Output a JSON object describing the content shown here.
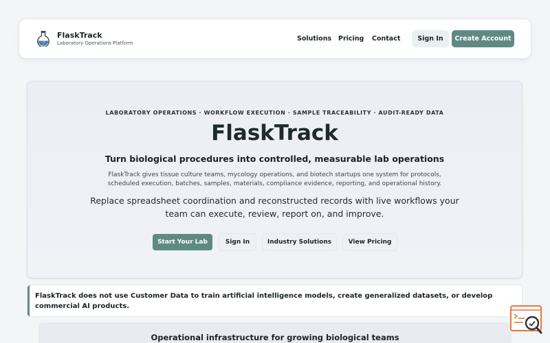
{
  "brand": {
    "name": "FlaskTrack",
    "tagline": "Laboratory Operations Platform",
    "logo_icon": "flask-icon"
  },
  "nav": {
    "links": [
      "Solutions",
      "Pricing",
      "Contact"
    ],
    "sign_in": "Sign In",
    "create_account": "Create Account"
  },
  "hero": {
    "eyebrow": "LABORATORY OPERATIONS · WORKFLOW EXECUTION · SAMPLE TRACEABILITY · AUDIT-READY DATA",
    "title": "FlaskTrack",
    "subtitle": "Turn biological procedures into controlled, measurable lab operations",
    "description": "FlaskTrack gives tissue culture teams, mycology operations, and biotech startups one system for protocols, scheduled execution, batches, samples, materials, compliance evidence, reporting, and operational history.",
    "lead": "Replace spreadsheet coordination and reconstructed records with live workflows your team can execute, review, report on, and improve.",
    "buttons": {
      "start": "Start Your Lab",
      "sign_in": "Sign In",
      "industry": "Industry Solutions",
      "pricing": "View Pricing"
    }
  },
  "notice": {
    "text": "FlaskTrack does not use Customer Data to train artificial intelligence models, create generalized datasets, or develop commercial AI products."
  },
  "section": {
    "title": "Operational infrastructure for growing biological teams"
  },
  "widget": {
    "icon": "chat-search-icon"
  },
  "colors": {
    "accent": "#5f8a84",
    "widget_orange": "#e8743b"
  }
}
